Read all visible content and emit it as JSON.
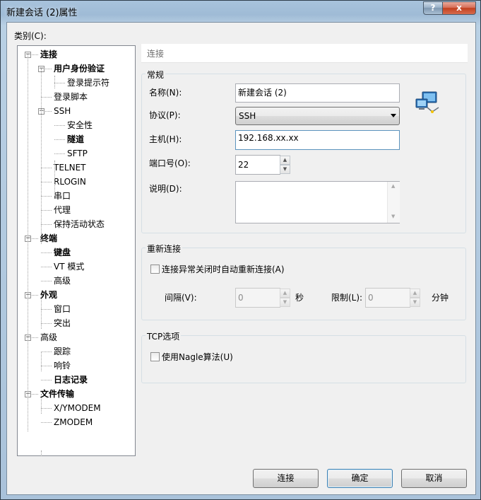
{
  "window": {
    "title": "新建会话 (2)属性",
    "help_glyph": "?",
    "close_glyph": "x"
  },
  "category_label": "类别(C):",
  "tree": [
    {
      "label": "连接",
      "bold": true,
      "expander": "minus"
    },
    {
      "label": "用户身份验证",
      "bold": true,
      "expander": "minus"
    },
    {
      "label": "登录提示符",
      "bold": false
    },
    {
      "label": "登录脚本",
      "bold": false
    },
    {
      "label": "SSH",
      "bold": false,
      "expander": "minus"
    },
    {
      "label": "安全性",
      "bold": false
    },
    {
      "label": "隧道",
      "bold": true
    },
    {
      "label": "SFTP",
      "bold": false
    },
    {
      "label": "TELNET",
      "bold": false
    },
    {
      "label": "RLOGIN",
      "bold": false
    },
    {
      "label": "串口",
      "bold": false
    },
    {
      "label": "代理",
      "bold": false
    },
    {
      "label": "保持活动状态",
      "bold": false
    },
    {
      "label": "终端",
      "bold": true,
      "expander": "minus"
    },
    {
      "label": "键盘",
      "bold": true
    },
    {
      "label": "VT 模式",
      "bold": false
    },
    {
      "label": "高级",
      "bold": false
    },
    {
      "label": "外观",
      "bold": true,
      "expander": "minus"
    },
    {
      "label": "窗口",
      "bold": false
    },
    {
      "label": "突出",
      "bold": false
    },
    {
      "label": "高级",
      "bold": false,
      "expander": "minus"
    },
    {
      "label": "跟踪",
      "bold": false
    },
    {
      "label": "响铃",
      "bold": false
    },
    {
      "label": "日志记录",
      "bold": true
    },
    {
      "label": "文件传输",
      "bold": true,
      "expander": "minus"
    },
    {
      "label": "X/YMODEM",
      "bold": false
    },
    {
      "label": "ZMODEM",
      "bold": false
    }
  ],
  "panel_header": "连接",
  "general": {
    "title": "常规",
    "name_label": "名称(N):",
    "name_value": "新建会话 (2)",
    "protocol_label": "协议(P):",
    "protocol_value": "SSH",
    "host_label": "主机(H):",
    "host_value": "192.168.xx.xx",
    "port_label": "端口号(O):",
    "port_value": "22",
    "desc_label": "说明(D):",
    "desc_value": ""
  },
  "reconnect": {
    "title": "重新连接",
    "auto_label": "连接异常关闭时自动重新连接(A)",
    "interval_label": "间隔(V):",
    "interval_value": "0",
    "interval_unit": "秒",
    "limit_label": "限制(L):",
    "limit_value": "0",
    "limit_unit": "分钟"
  },
  "tcp": {
    "title": "TCP选项",
    "nagle_label": "使用Nagle算法(U)"
  },
  "buttons": {
    "connect": "连接",
    "ok": "确定",
    "cancel": "取消"
  },
  "colors": {
    "title_bar": "#a8c3dc",
    "close_button": "#c2401f",
    "dialog_bg": "#f0f0f0"
  }
}
